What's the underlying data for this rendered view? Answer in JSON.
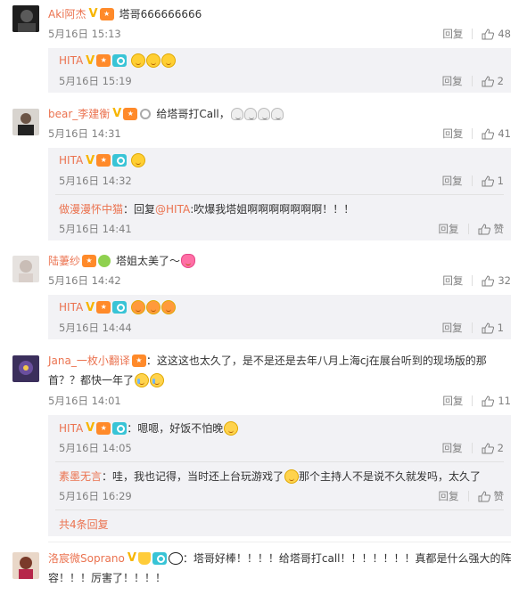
{
  "comments": [
    {
      "user": "Aki阿杰",
      "text": "塔哥666666666",
      "time": "5月16日 15:13",
      "reply_label": "回复",
      "likes": "48",
      "replies": [
        {
          "user": "HITA",
          "text": "",
          "time": "5月16日 15:19",
          "reply_label": "回复",
          "likes": "2"
        }
      ]
    },
    {
      "user": "bear_李建衡",
      "text": "给塔哥打Call，",
      "time": "5月16日 14:31",
      "reply_label": "回复",
      "likes": "41",
      "replies": [
        {
          "user": "HITA",
          "text": "",
          "time": "5月16日 14:32",
          "reply_label": "回复",
          "likes": "1"
        },
        {
          "user": "做漫漫怀中猫",
          "reply_prefix": "：回复",
          "reply_to": "@HITA",
          "text": ":吹爆我塔姐啊啊啊啊啊啊啊！！！",
          "time": "5月16日 14:41",
          "reply_label": "回复",
          "likes": "赞"
        }
      ]
    },
    {
      "user": "陆萋纱",
      "text": "塔姐太美了～",
      "time": "5月16日 14:42",
      "reply_label": "回复",
      "likes": "32",
      "replies": [
        {
          "user": "HITA",
          "text": "",
          "time": "5月16日 14:44",
          "reply_label": "回复",
          "likes": "1"
        }
      ]
    },
    {
      "user": "Jana_一枚小翻译",
      "text": "：这这这也太久了，是不是还是去年八月上海cj在展台听到的现场版的那",
      "text2": "首？？都快一年了",
      "time": "5月16日 14:01",
      "reply_label": "回复",
      "likes": "11",
      "replies": [
        {
          "user": "HITA",
          "text": "：嗯嗯，好饭不怕晚",
          "time": "5月16日 14:05",
          "reply_label": "回复",
          "likes": "2"
        },
        {
          "user": "素墨无言",
          "text": "：哇，我也记得，当时还上台玩游戏了",
          "text_b": "那个主持人不是说不久就发吗，太久了",
          "time": "5月16日 16:29",
          "reply_label": "回复",
          "likes": "赞"
        }
      ],
      "more": "共4条回复"
    },
    {
      "user": "洛宸微Soprano",
      "text": "：塔哥好棒！！！！给塔哥打call！！！！！！！真都是什么强大的阵",
      "text2": "容！！！厉害了！！！！"
    }
  ]
}
